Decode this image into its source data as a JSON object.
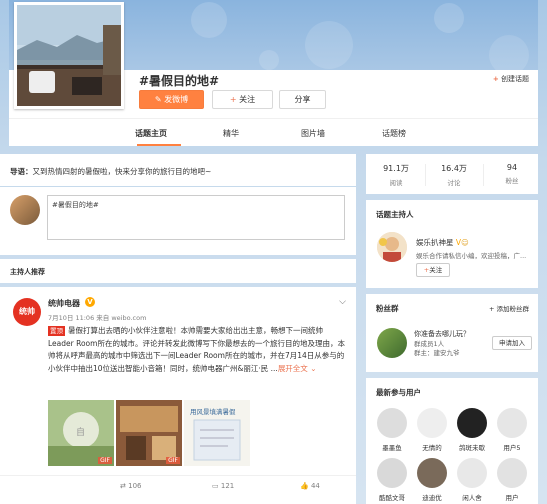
{
  "topic": {
    "title": "#暑假目的地#",
    "create_label": "创建话题",
    "post_button": "发微博",
    "follow_button": "关注",
    "share_button": "分享"
  },
  "tabs": [
    "话题主页",
    "精华",
    "图片墙",
    "话题榜"
  ],
  "guide": {
    "label": "导语：",
    "text": "又到热情四射的暑假啦，快来分享你的旅行目的地吧~"
  },
  "composer": {
    "value": "#暑假目的地#"
  },
  "host_recommend_title": "主持人推荐",
  "post": {
    "brand_logo_text": "统帅",
    "author": "统帅电器",
    "time_source": "7月10日 11:06 来自 weibo.com",
    "hot_tag": "置顶",
    "body": "暑假打算出去晒的小伙伴注意啦！本帅需要大家给出出主意，畅想下一间统帅Leader Room所在的城市。评论并转发此微博写下你最想去的一个旅行目的地及理由，本帅将从呼声最高的城市中筛选出下一间Leader Room所在的城市，并在7月14日从参与的小伙伴中抽出10位送出智能小音箱！同时，统帅电器广州&丽江·民 ...",
    "expand": "展开全文 ⌄",
    "gif_labels": [
      "GIF",
      "GIF"
    ],
    "thumb3_text": "用风景填满暑假",
    "reposts": "106",
    "comments": "121",
    "likes": "44"
  },
  "stats": [
    {
      "value": "91.1万",
      "label": "阅读"
    },
    {
      "value": "16.4万",
      "label": "讨论"
    },
    {
      "value": "94",
      "label": "粉丝"
    }
  ],
  "host": {
    "title": "话题主持人",
    "name": "娱乐扒神星",
    "desc": "娱乐合作请私信小编，欢迎投稿，广...",
    "follow": "关注"
  },
  "fans": {
    "title": "粉丝群",
    "create": "添加粉丝群",
    "group_name": "你准备去哪儿玩？",
    "members": "群成员1人",
    "owner": "群主：建安九爷",
    "apply": "申请加入"
  },
  "recent": {
    "title": "最新参与用户",
    "users": [
      "墨墨鱼",
      "无情的",
      "鸽斑未歇",
      "用户5",
      "酷酷文哥",
      "迪迪优",
      "闲人舍",
      "用户"
    ]
  },
  "colors": {
    "accent": "#ff8140",
    "brand_red": "#e43222",
    "link": "#eb7350"
  }
}
